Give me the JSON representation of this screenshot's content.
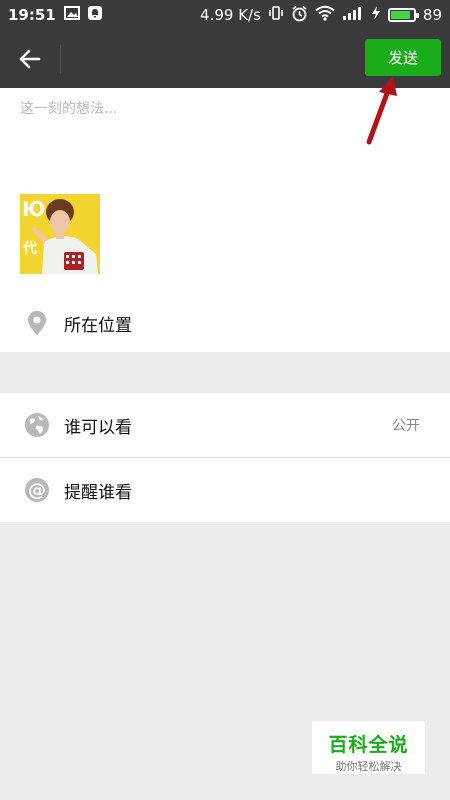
{
  "status": {
    "time": "19:51",
    "speed": "4.99 K/s",
    "battery": "89",
    "battery_level": 0.89
  },
  "header": {
    "send_label": "发送"
  },
  "composer": {
    "placeholder": "这一刻的想法...",
    "thumb_text": "代"
  },
  "rows": {
    "location_label": "所在位置",
    "visible_label": "谁可以看",
    "visible_value": "公开",
    "remind_label": "提醒谁看"
  },
  "watermark": {
    "title": "百科全说",
    "subtitle": "助你轻松解决"
  },
  "colors": {
    "topbar": "#3a3a3c",
    "send": "#1aad19",
    "arrow": "#b01217",
    "background": "#ececec"
  },
  "icons": [
    "image-icon",
    "notification-icon",
    "vibrate-icon",
    "alarm-icon",
    "wifi-icon",
    "signal-icon",
    "charging-icon",
    "battery-icon",
    "back-arrow-icon",
    "location-pin-icon",
    "globe-icon",
    "at-icon"
  ]
}
